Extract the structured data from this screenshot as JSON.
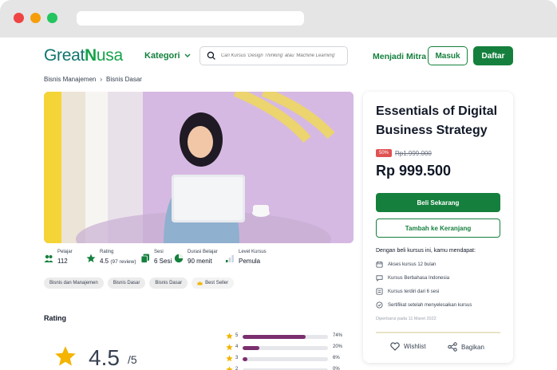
{
  "header": {
    "logo_a": "Great",
    "logo_b": "N",
    "logo_c": "usa",
    "kategori_label": "Kategori",
    "search_placeholder": "Cari Kursus 'Design Thinking' atau 'Machine Learning'",
    "mitra_label": "Menjadi Mitra",
    "masuk_label": "Masuk",
    "daftar_label": "Daftar"
  },
  "breadcrumb": [
    "Bisnis Manajemen",
    "Bisnis Dasar"
  ],
  "stats": [
    {
      "label": "Pelajar",
      "value": "112",
      "icon": "users-icon"
    },
    {
      "label": "Rating",
      "value": "4.5",
      "extra": "(97 review)",
      "icon": "star-icon"
    },
    {
      "label": "Sesi",
      "value": "6 Sesi",
      "icon": "copy-icon"
    },
    {
      "label": "Durasi Belajar",
      "value": "90 menit",
      "icon": "clock-icon"
    },
    {
      "label": "Level Kursus",
      "value": "Pemula",
      "icon": "level-icon"
    }
  ],
  "tags": [
    "Bisnis dan Manajemen",
    "Bisnis Dasar",
    "Bisnis Dasar",
    "Best Seller"
  ],
  "rating": {
    "title": "Rating",
    "score": "4.5",
    "of": "/5",
    "rows": [
      {
        "star": "5",
        "pct_label": "74%",
        "pct": 74
      },
      {
        "star": "4",
        "pct_label": "20%",
        "pct": 20
      },
      {
        "star": "3",
        "pct_label": "6%",
        "pct": 6
      },
      {
        "star": "2",
        "pct_label": "0%",
        "pct": 0
      }
    ]
  },
  "card": {
    "title": "Essentials of Digital Business Strategy",
    "discount": "50%",
    "old_price": "Rp1.999.000",
    "price": "Rp 999.500",
    "buy_label": "Beli Sekarang",
    "cart_label": "Tambah ke Keranjang",
    "benefit_head": "Dengan beli kursus ini, kamu mendapat:",
    "benefits": [
      {
        "text": "Akses kursus 12 bulan",
        "icon": "calendar-icon"
      },
      {
        "text": "Kursus Berbahasa Indonesia",
        "icon": "chat-icon"
      },
      {
        "text": "Kursus terdiri dari 6 sesi",
        "icon": "list-icon"
      },
      {
        "text": "Sertifikat setelah menyelesaikan kursus",
        "icon": "check-circle-icon"
      }
    ],
    "published": "Diperbarui pada 11 Maret 2022",
    "wishlist_label": "Wishlist",
    "share_label": "Bagikan"
  },
  "colors": {
    "brand_green": "#15803d",
    "bar_purple": "#7b2f6e",
    "star_gold": "#f4b400",
    "discount_red": "#e05252"
  }
}
